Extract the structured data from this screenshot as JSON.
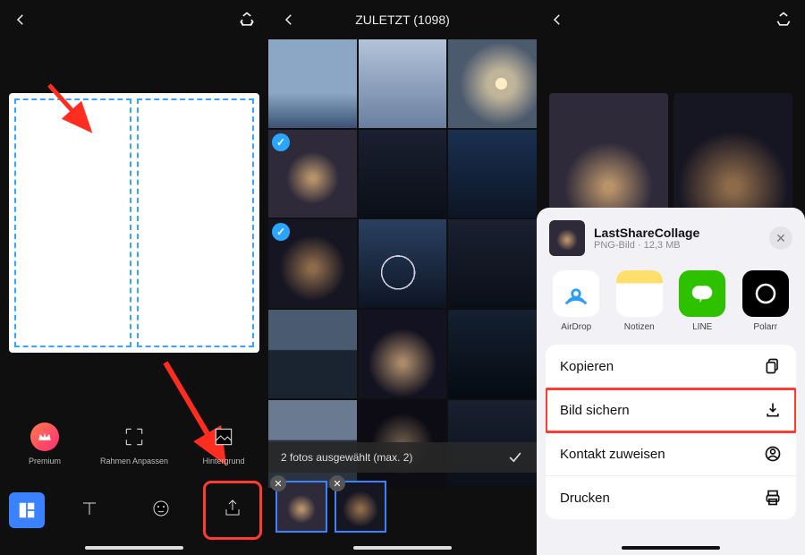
{
  "phone1": {
    "tools_a": {
      "premium": "Premium",
      "frame": "Rahmen Anpassen",
      "background": "Hintergrund"
    }
  },
  "phone2": {
    "title": "ZULETZT (1098)",
    "status": "2 fotos ausgewählt (max. 2)"
  },
  "phone3": {
    "sheet": {
      "title": "LastShareCollage",
      "subtitle": "PNG-Bild · 12,3 MB",
      "apps": {
        "airdrop": "AirDrop",
        "notes": "Notizen",
        "line": "LINE",
        "polarr": "Polarr"
      },
      "actions": {
        "copy": "Kopieren",
        "save": "Bild sichern",
        "contact": "Kontakt zuweisen",
        "print": "Drucken"
      }
    }
  }
}
